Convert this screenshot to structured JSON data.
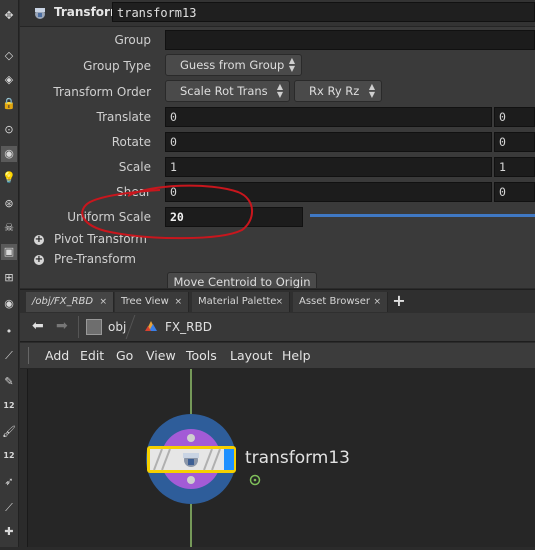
{
  "param_header": {
    "node_type": "Transform",
    "node_name": "transform13"
  },
  "params": {
    "group": {
      "label": "Group",
      "value": ""
    },
    "group_type": {
      "label": "Group Type",
      "value": "Guess from Group"
    },
    "transform_order": {
      "label": "Transform Order",
      "value": "Scale Rot Trans",
      "rot_order": "Rx Ry Rz"
    },
    "translate": {
      "label": "Translate",
      "x": "0",
      "y": "0"
    },
    "rotate": {
      "label": "Rotate",
      "x": "0",
      "y": "0"
    },
    "scale": {
      "label": "Scale",
      "x": "1",
      "y": "1"
    },
    "shear": {
      "label": "Shear",
      "x": "0",
      "y": "0"
    },
    "uniform_scale": {
      "label": "Uniform Scale",
      "value": "20"
    },
    "folders": [
      "Pivot Transform",
      "Pre-Transform"
    ],
    "move_centroid_button": "Move Centroid to Origin"
  },
  "tabs": [
    {
      "label": "/obj/FX_RBD",
      "close": "×"
    },
    {
      "label": "Tree View",
      "close": "×"
    },
    {
      "label": "Material Palette",
      "close": "×"
    },
    {
      "label": "Asset Browser",
      "close": "×"
    }
  ],
  "add_tab": "+",
  "path": {
    "root": "obj",
    "current": "FX_RBD"
  },
  "menu": [
    "Add",
    "Edit",
    "Go",
    "View",
    "Tools",
    "Layout",
    "Help"
  ],
  "network": {
    "node_label": "transform13"
  },
  "toolbar": {
    "labels_12a": "12",
    "labels_12b": "12"
  },
  "colors": {
    "annotation": "#c8161d",
    "node_selected": "#f5d000",
    "display_flag": "#1e90ff",
    "ring_outer": "#2e5d9a",
    "ring_inner": "#a35bd6"
  }
}
